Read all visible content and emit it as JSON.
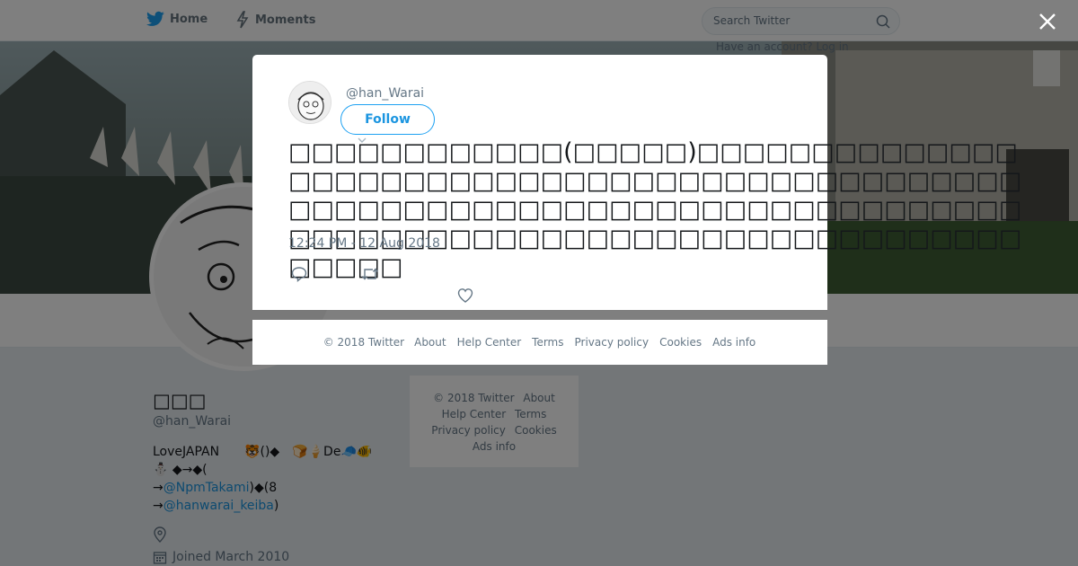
{
  "nav": {
    "home_label": "Home",
    "moments_label": "Moments",
    "search_placeholder": "Search Twitter",
    "have_account": "Have an account? Log in"
  },
  "profile": {
    "fullname": "□□□",
    "screen_name": "@han_Warai",
    "bio": {
      "line1": "LoveJAPAN　　🐯()◆　🍞🍦De🧢🐠",
      "line2": "⛄ ◆→◆(",
      "line3_prefix": "→",
      "line3_link": "@NpmTakami",
      "line3_suffix": ")◆(8",
      "line4_prefix": "→",
      "line4_link": "@hanwarai_keiba",
      "line4_suffix": ")"
    },
    "joined": "Joined March 2010"
  },
  "page_footer": {
    "copyright": "© 2018 Twitter",
    "about": "About",
    "help": "Help Center",
    "terms": "Terms",
    "privacy": "Privacy policy",
    "cookies": "Cookies",
    "ads": "Ads info"
  },
  "modal": {
    "handle": "@han_Warai",
    "follow_label": "Follow",
    "tweet_text": "□□□□□□□□□□□□(□□□□□)□□□□□□□□□□□□□□□□□□□□□□□□□□□□□□□□□□□□□□□□□□□□□□□□□□□□□□□□□□□□□□□□□□□□□□□□□□□□□□□□□□□□□□□□□□□□□□□□□□□□□□□□□□□□□□□□□□□",
    "timestamp": "12:24 PM - 12 Aug 2018"
  },
  "modal_footer": {
    "copyright": "© 2018 Twitter",
    "about": "About",
    "help": "Help Center",
    "terms": "Terms",
    "privacy": "Privacy policy",
    "cookies": "Cookies",
    "ads": "Ads info"
  },
  "icons": {
    "twitter_bird": "twitter-bird-icon",
    "moments": "lightning-icon",
    "search": "search-icon",
    "close": "close-icon",
    "reply": "reply-icon",
    "retweet": "retweet-icon",
    "like": "heart-icon",
    "location": "location-pin-icon",
    "calendar": "calendar-icon"
  },
  "colors": {
    "brand": "#1da1f2",
    "link": "#1b95e0",
    "muted": "#657786",
    "overlay": "rgba(0,0,0,0.5)"
  }
}
